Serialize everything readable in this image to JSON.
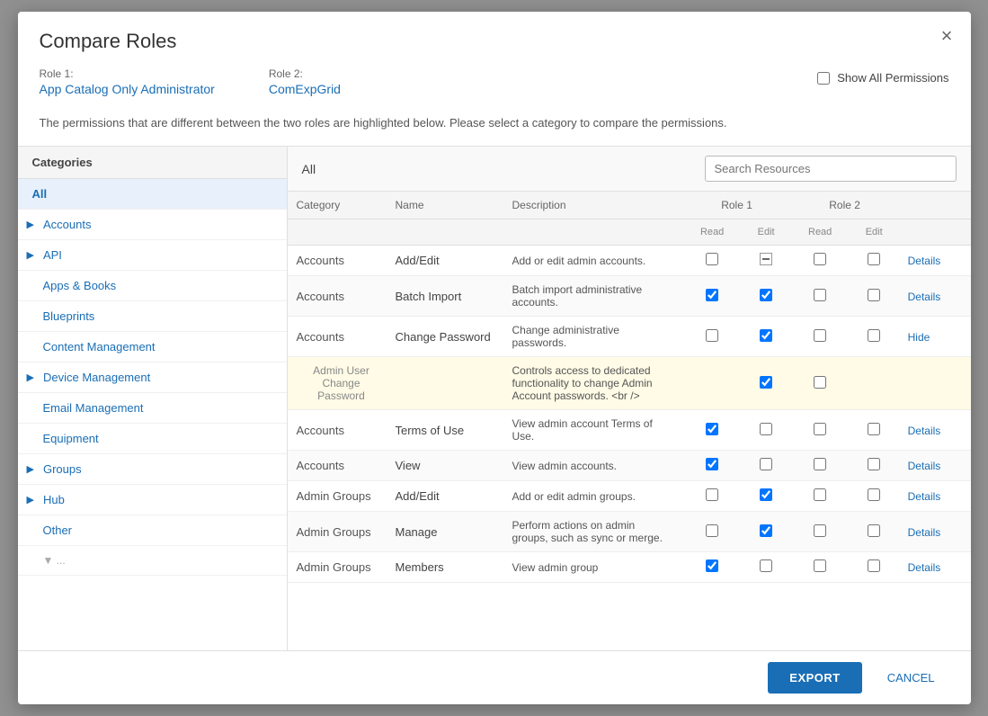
{
  "modal": {
    "title": "Compare Roles",
    "close_label": "×"
  },
  "roles": {
    "role1_label": "Role 1:",
    "role1_value": "App Catalog Only Administrator",
    "role2_label": "Role 2:",
    "role2_value": "ComExpGrid"
  },
  "show_all_permissions": {
    "label": "Show All Permissions"
  },
  "description": "The permissions that are different between the two roles are highlighted below. Please select a category to compare the permissions.",
  "categories": {
    "header": "Categories",
    "items": [
      {
        "label": "All",
        "selected": true,
        "arrow": false,
        "indent": false
      },
      {
        "label": "Accounts",
        "selected": false,
        "arrow": true,
        "indent": true
      },
      {
        "label": "API",
        "selected": false,
        "arrow": true,
        "indent": true
      },
      {
        "label": "Apps & Books",
        "selected": false,
        "arrow": false,
        "indent": true
      },
      {
        "label": "Blueprints",
        "selected": false,
        "arrow": false,
        "indent": true
      },
      {
        "label": "Content Management",
        "selected": false,
        "arrow": false,
        "indent": true
      },
      {
        "label": "Device Management",
        "selected": false,
        "arrow": true,
        "indent": true
      },
      {
        "label": "Email Management",
        "selected": false,
        "arrow": false,
        "indent": true
      },
      {
        "label": "Equipment",
        "selected": false,
        "arrow": false,
        "indent": true
      },
      {
        "label": "Groups",
        "selected": false,
        "arrow": true,
        "indent": true
      },
      {
        "label": "Hub",
        "selected": false,
        "arrow": true,
        "indent": true
      },
      {
        "label": "Other",
        "selected": false,
        "arrow": false,
        "indent": true
      }
    ]
  },
  "content": {
    "title": "All",
    "search_placeholder": "Search Resources",
    "table": {
      "headers": {
        "category": "Category",
        "name": "Name",
        "description": "Description",
        "role1": "Role 1",
        "role2": "Role 2",
        "read": "Read",
        "edit": "Edit"
      },
      "rows": [
        {
          "category": "Accounts",
          "name": "Add/Edit",
          "description": "Add or edit admin accounts.",
          "role1_read": false,
          "role1_edit": "minus",
          "role2_read": false,
          "role2_edit": false,
          "action": "Details",
          "highlighted": false,
          "indent": false
        },
        {
          "category": "Accounts",
          "name": "Batch Import",
          "description": "Batch import administrative accounts.",
          "role1_read": true,
          "role1_edit": true,
          "role2_read": false,
          "role2_edit": false,
          "action": "Details",
          "highlighted": false,
          "indent": false
        },
        {
          "category": "Accounts",
          "name": "Change Password",
          "description": "Change administrative passwords.",
          "role1_read": false,
          "role1_edit": true,
          "role2_read": false,
          "role2_edit": false,
          "action": "Hide",
          "highlighted": false,
          "indent": false
        },
        {
          "category": "",
          "name": "Admin User Change Password",
          "description": "Controls access to dedicated functionality to change Admin Account passwords. <br />",
          "role1_read": null,
          "role1_edit": true,
          "role2_read": false,
          "role2_edit": null,
          "action": "",
          "highlighted": true,
          "indent": true
        },
        {
          "category": "Accounts",
          "name": "Terms of Use",
          "description": "View admin account Terms of Use.",
          "role1_read": true,
          "role1_edit": false,
          "role2_read": false,
          "role2_edit": false,
          "action": "Details",
          "highlighted": false,
          "indent": false
        },
        {
          "category": "Accounts",
          "name": "View",
          "description": "View admin accounts.",
          "role1_read": true,
          "role1_edit": false,
          "role2_read": false,
          "role2_edit": false,
          "action": "Details",
          "highlighted": false,
          "indent": false
        },
        {
          "category": "Admin Groups",
          "name": "Add/Edit",
          "description": "Add or edit admin groups.",
          "role1_read": false,
          "role1_edit": true,
          "role2_read": false,
          "role2_edit": false,
          "action": "Details",
          "highlighted": false,
          "indent": false
        },
        {
          "category": "Admin Groups",
          "name": "Manage",
          "description": "Perform actions on admin groups, such as sync or merge.",
          "role1_read": false,
          "role1_edit": true,
          "role2_read": false,
          "role2_edit": false,
          "action": "Details",
          "highlighted": false,
          "indent": false
        },
        {
          "category": "Admin Groups",
          "name": "Members",
          "description": "View admin group",
          "role1_read": true,
          "role1_edit": false,
          "role2_read": false,
          "role2_edit": false,
          "action": "Details",
          "highlighted": false,
          "indent": false
        }
      ]
    }
  },
  "footer": {
    "export_label": "EXPORT",
    "cancel_label": "CANCEL"
  }
}
